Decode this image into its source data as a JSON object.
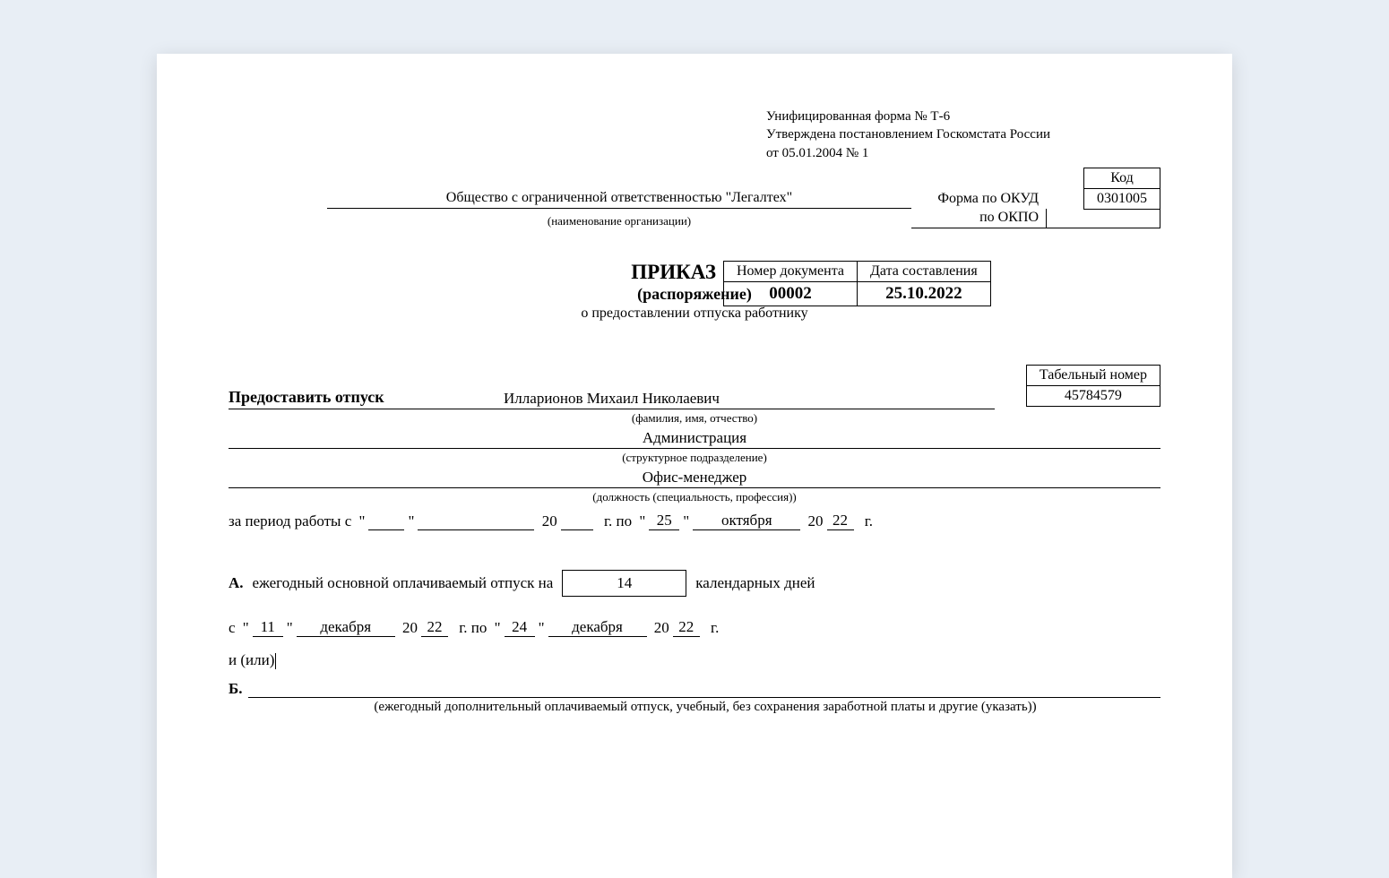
{
  "form_header": {
    "line1": "Унифицированная форма № Т-6",
    "line2": "Утверждена постановлением Госкомстата России",
    "line3": "от 05.01.2004 № 1"
  },
  "codes": {
    "header": "Код",
    "okud_label": "Форма по ОКУД",
    "okud_value": "0301005",
    "okpo_label": "по ОКПО",
    "okpo_value": ""
  },
  "org": {
    "name": "Общество с ограниченной ответственностью \"Легалтех\"",
    "caption": "(наименование организации)"
  },
  "doc": {
    "num_label": "Номер документа",
    "date_label": "Дата составления",
    "number": "00002",
    "date": "25.10.2022"
  },
  "title": {
    "main": "ПРИКАЗ",
    "sub1": "(распоряжение)",
    "sub2": "о предоставлении отпуска работнику"
  },
  "grant": {
    "label": "Предоставить отпуск",
    "tab_label": "Табельный номер",
    "tab_value": "45784579"
  },
  "employee": {
    "fio": "Илларионов Михаил Николаевич",
    "fio_caption": "(фамилия, имя, отчество)",
    "dept": "Администрация",
    "dept_caption": "(структурное подразделение)",
    "post": "Офис-менеджер",
    "post_caption": "(должность (специальность, профессия))"
  },
  "period": {
    "prefix": "за период работы с",
    "from_day": "",
    "from_month": "",
    "from_yy": "",
    "mid": "г.   по",
    "to_day": "25",
    "to_month": "октября",
    "to_yy": "22",
    "suffix": "г."
  },
  "section_a": {
    "label": "А.",
    "text": "ежегодный основной оплачиваемый отпуск на",
    "days": "14",
    "days_unit": "календарных дней",
    "from_prefix": "с",
    "from_day": "11",
    "from_month": "декабря",
    "from_yy": "22",
    "mid": "г.   по",
    "to_day": "24",
    "to_month": "декабря",
    "to_yy": "22",
    "suffix": "г."
  },
  "and_or": "и (или)",
  "section_b": {
    "label": "Б.",
    "caption": "(ежегодный дополнительный оплачиваемый отпуск, учебный, без сохранения заработной платы и другие (указать))"
  }
}
